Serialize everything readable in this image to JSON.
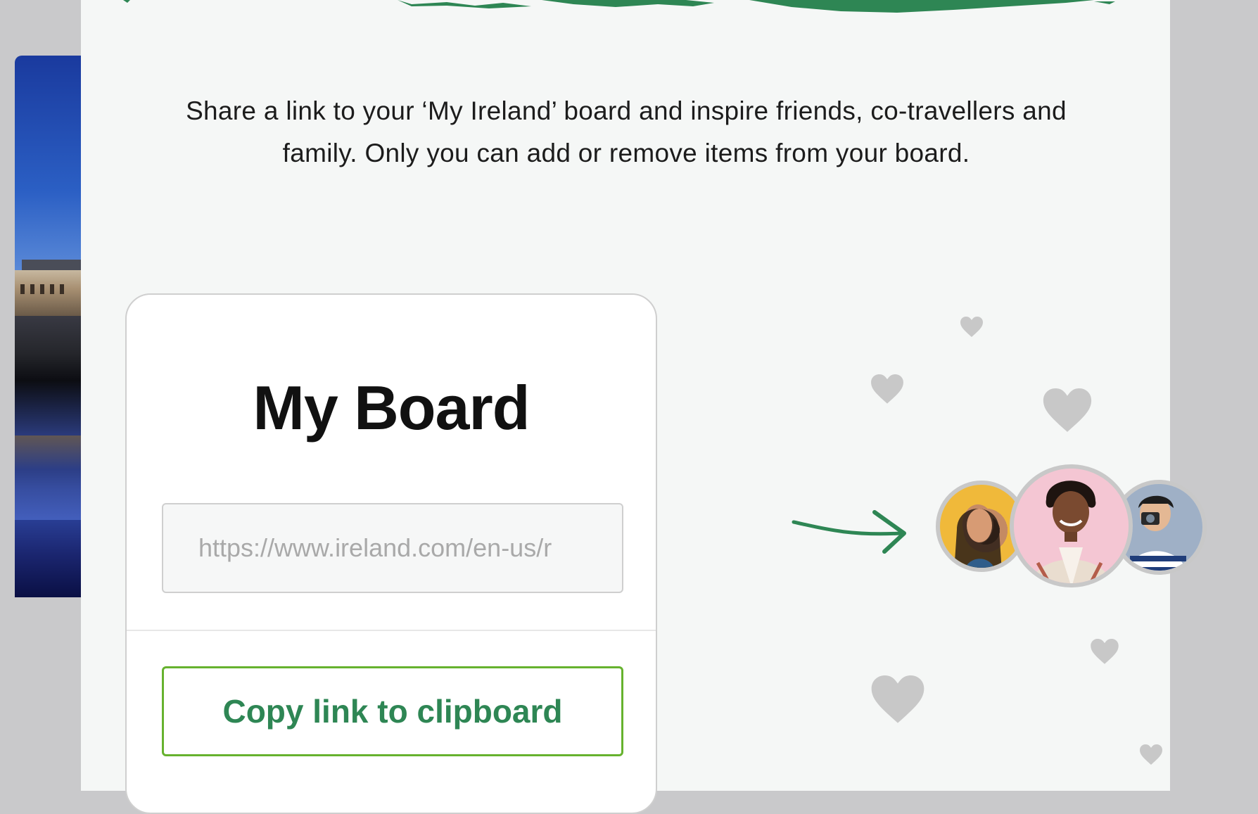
{
  "intro": {
    "line1": "Share a link to your ‘My Ireland’ board and inspire friends, co-travellers and",
    "line2": "family. Only you can add or remove items from your board."
  },
  "board": {
    "title": "My Board",
    "link_value": "https://www.ireland.com/en-us/r",
    "copy_label": "Copy link to clipboard"
  },
  "colors": {
    "brand_green": "#2e8654",
    "button_border": "#66b22e",
    "heart_gray": "#c8c8c8"
  },
  "icons": {
    "arrow": "arrow-right-icon",
    "heart": "heart-icon"
  }
}
